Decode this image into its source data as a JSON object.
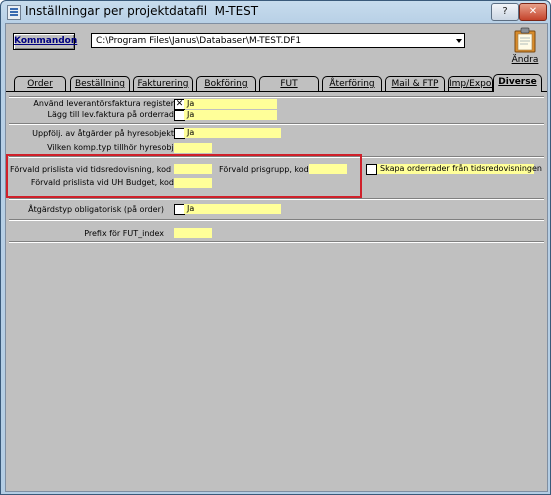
{
  "window": {
    "title": "Inställningar per projektdatafil  M-TEST",
    "help_label": "?",
    "close_label": "✕"
  },
  "toolbar": {
    "kommandon_label": "Kommandon",
    "path_value": "C:\\Program Files\\Janus\\Databaser\\M-TEST.DF1",
    "andra_label": "Ändra"
  },
  "tabs": [
    {
      "label": "Order"
    },
    {
      "label": "Beställning"
    },
    {
      "label": "Fakturering"
    },
    {
      "label": "Bokföring"
    },
    {
      "label": "FUT"
    },
    {
      "label": "Återföring"
    },
    {
      "label": "Mail & FTP"
    },
    {
      "label": "Imp/Export"
    },
    {
      "label": "Diverse"
    }
  ],
  "active_tab": "Diverse",
  "settings": {
    "lev_register_label": "Använd leverantörsfaktura register",
    "lev_register_checked": "✕",
    "lev_register_value": "Ja",
    "lev_orderrad_label": "Lägg till lev.faktura på orderrad",
    "lev_orderrad_value": "Ja",
    "uppfolj_label": "Uppfölj. av åtgärder på hyresobjekt",
    "uppfolj_value": "Ja",
    "komp_typ_label": "Vilken komp.typ tillhör hyresobjekt...",
    "komp_typ_value": "",
    "prislista_tid_label": "Förvald prislista vid tidsredovisning, kod",
    "prislista_tid_value": "",
    "prisgrupp_label": "Förvald prisgrupp, kod",
    "prisgrupp_value": "",
    "skapa_orderrader_label": "Skapa orderrader från tidsredovisningen",
    "prislista_uh_label": "Förvald prislista vid UH Budget, kod",
    "prislista_uh_value": "",
    "atgardstyp_label": "Åtgärdstyp obligatorisk (på order)",
    "atgardstyp_value": "Ja",
    "prefix_label": "Prefix för FUT_index",
    "prefix_value": ""
  },
  "colors": {
    "field_yellow": "#ffff99",
    "highlight_red": "#d0202a",
    "form_gray": "#c0c0c0"
  }
}
